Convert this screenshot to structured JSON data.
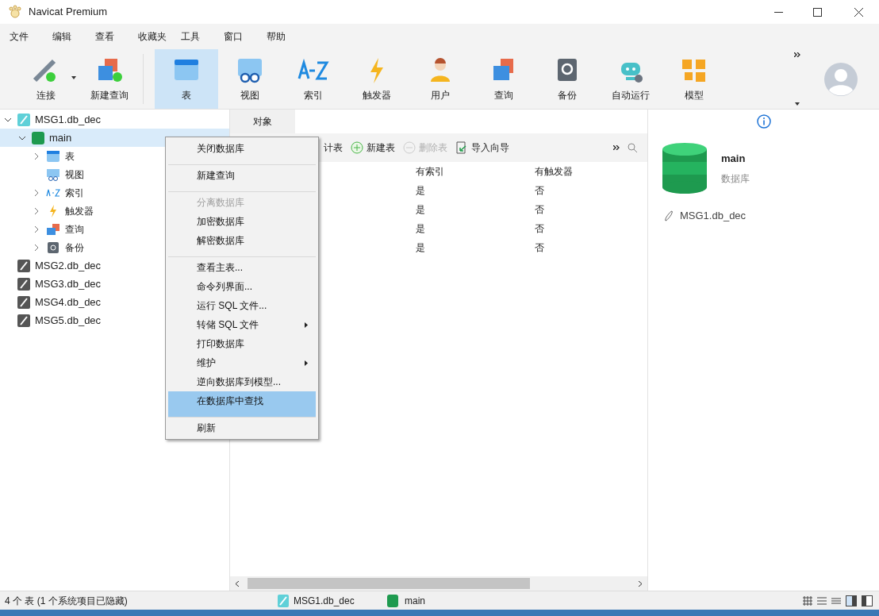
{
  "window": {
    "title": "Navicat Premium"
  },
  "menu_bar": [
    "文件",
    "编辑",
    "查看",
    "收藏夹",
    "工具",
    "窗口",
    "帮助"
  ],
  "toolbar": [
    {
      "label": "连接",
      "selected": false,
      "dropdown": true
    },
    {
      "label": "新建查询",
      "selected": false,
      "dropdown": false
    },
    {
      "label": "表",
      "selected": true,
      "dropdown": false
    },
    {
      "label": "视图",
      "selected": false,
      "dropdown": false
    },
    {
      "label": "索引",
      "selected": false,
      "dropdown": false
    },
    {
      "label": "触发器",
      "selected": false,
      "dropdown": false
    },
    {
      "label": "用户",
      "selected": false,
      "dropdown": false
    },
    {
      "label": "查询",
      "selected": false,
      "dropdown": false
    },
    {
      "label": "备份",
      "selected": false,
      "dropdown": false
    },
    {
      "label": "自动运行",
      "selected": false,
      "dropdown": false
    },
    {
      "label": "模型",
      "selected": false,
      "dropdown": false
    }
  ],
  "sidebar": {
    "tree": [
      {
        "label": "MSG1.db_dec",
        "kind": "connection",
        "expanded": true,
        "selected": false,
        "children": [
          {
            "label": "main",
            "kind": "database",
            "expanded": true,
            "selected": true,
            "children": [
              {
                "label": "表",
                "kind": "table",
                "expanded": false,
                "selected": false
              },
              {
                "label": "视图",
                "kind": "view",
                "selected": false
              },
              {
                "label": "索引",
                "kind": "index",
                "expanded": false,
                "selected": false
              },
              {
                "label": "触发器",
                "kind": "trigger",
                "expanded": false,
                "selected": false
              },
              {
                "label": "查询",
                "kind": "query",
                "expanded": false,
                "selected": false
              },
              {
                "label": "备份",
                "kind": "backup",
                "expanded": false,
                "selected": false
              }
            ]
          }
        ]
      },
      {
        "label": "MSG2.db_dec",
        "kind": "file",
        "selected": false
      },
      {
        "label": "MSG3.db_dec",
        "kind": "file",
        "selected": false
      },
      {
        "label": "MSG4.db_dec",
        "kind": "file",
        "selected": false
      },
      {
        "label": "MSG5.db_dec",
        "kind": "file",
        "selected": false
      }
    ]
  },
  "object_tab": {
    "label": "对象"
  },
  "object_toolbar": [
    {
      "label": "计表",
      "disabled": false
    },
    {
      "label": "新建表",
      "disabled": false
    },
    {
      "label": "删除表",
      "disabled": true
    },
    {
      "label": "导入向导",
      "disabled": false
    }
  ],
  "table": {
    "columns": [
      "有索引",
      "有触发器"
    ],
    "rows": [
      [
        "是",
        "否"
      ],
      [
        "是",
        "否"
      ],
      [
        "是",
        "否"
      ],
      [
        "是",
        "否"
      ]
    ]
  },
  "context_menu": [
    {
      "label": "关闭数据库",
      "disabled": false,
      "submenu": false,
      "separator_after": true,
      "selected": false
    },
    {
      "label": "新建查询",
      "disabled": false,
      "submenu": false,
      "separator_after": true,
      "selected": false
    },
    {
      "label": "分离数据库",
      "disabled": true,
      "submenu": false,
      "separator_after": false,
      "selected": false
    },
    {
      "label": "加密数据库",
      "disabled": false,
      "submenu": false,
      "separator_after": false,
      "selected": false
    },
    {
      "label": "解密数据库",
      "disabled": false,
      "submenu": false,
      "separator_after": true,
      "selected": false
    },
    {
      "label": "查看主表...",
      "disabled": false,
      "submenu": false,
      "separator_after": false,
      "selected": false
    },
    {
      "label": "命令列界面...",
      "disabled": false,
      "submenu": false,
      "separator_after": false,
      "selected": false
    },
    {
      "label": "运行 SQL 文件...",
      "disabled": false,
      "submenu": false,
      "separator_after": false,
      "selected": false
    },
    {
      "label": "转储 SQL 文件",
      "disabled": false,
      "submenu": true,
      "separator_after": false,
      "selected": false
    },
    {
      "label": "打印数据库",
      "disabled": false,
      "submenu": false,
      "separator_after": false,
      "selected": false
    },
    {
      "label": "维护",
      "disabled": false,
      "submenu": true,
      "separator_after": false,
      "selected": false
    },
    {
      "label": "逆向数据库到模型...",
      "disabled": false,
      "submenu": false,
      "separator_after": false,
      "selected": false
    },
    {
      "label": "在数据库中查找",
      "disabled": false,
      "submenu": false,
      "separator_after": true,
      "selected": true
    },
    {
      "label": "刷新",
      "disabled": false,
      "submenu": false,
      "separator_after": false,
      "selected": false
    }
  ],
  "info_pane": {
    "name": "main",
    "type": "数据库",
    "file": "MSG1.db_dec"
  },
  "status_bar": {
    "count": "4 个 表 (1 个系统项目已隐藏)",
    "connection": "MSG1.db_dec",
    "database": "main"
  }
}
